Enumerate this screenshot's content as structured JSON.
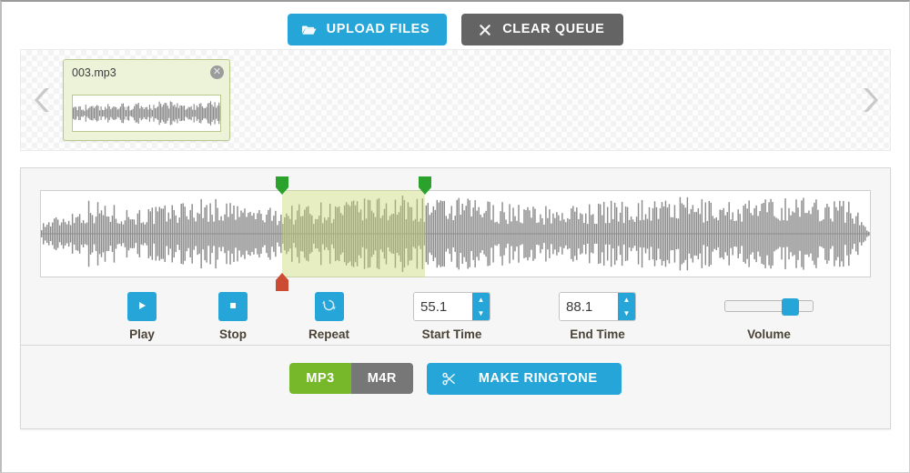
{
  "toolbar": {
    "upload_label": "UPLOAD FILES",
    "upload_icon": "folder-open-icon",
    "clear_label": "CLEAR QUEUE",
    "clear_icon": "close-x-icon"
  },
  "queue": {
    "prev_arrow_icon": "chevron-left-icon",
    "next_arrow_icon": "chevron-right-icon",
    "files": [
      {
        "name": "003.mp3",
        "close_icon": "close-circle-icon",
        "selected": true
      }
    ]
  },
  "editor": {
    "waveform": {
      "selection_start_percent": 29.1,
      "selection_end_percent": 46.3,
      "playhead_percent": 29.1,
      "start_marker_icon": "marker-green-down-icon",
      "end_marker_icon": "marker-green-down-icon",
      "playhead_marker_icon": "marker-red-up-icon"
    },
    "controls": {
      "play": {
        "label": "Play",
        "icon": "play-icon"
      },
      "stop": {
        "label": "Stop",
        "icon": "stop-icon"
      },
      "repeat": {
        "label": "Repeat",
        "icon": "repeat-icon"
      },
      "start_time": {
        "label": "Start Time",
        "value": "55.1"
      },
      "end_time": {
        "label": "End Time",
        "value": "88.1"
      },
      "volume": {
        "label": "Volume",
        "value": 78
      },
      "spinner_up_icon": "caret-up-icon",
      "spinner_down_icon": "caret-down-icon"
    },
    "footer": {
      "format_mp3": "MP3",
      "format_m4r": "M4R",
      "active_format": "MP3",
      "make_ringtone_label": "MAKE RINGTONE",
      "make_ringtone_icon": "scissors-icon"
    }
  },
  "colors": {
    "accent_blue": "#26a6d8",
    "accent_green": "#76b82a",
    "gray_button": "#646464",
    "marker_green": "#2ba22b",
    "marker_red": "#cc4b33",
    "selection": "#c5d66e",
    "card_bg": "#edf3d8"
  }
}
